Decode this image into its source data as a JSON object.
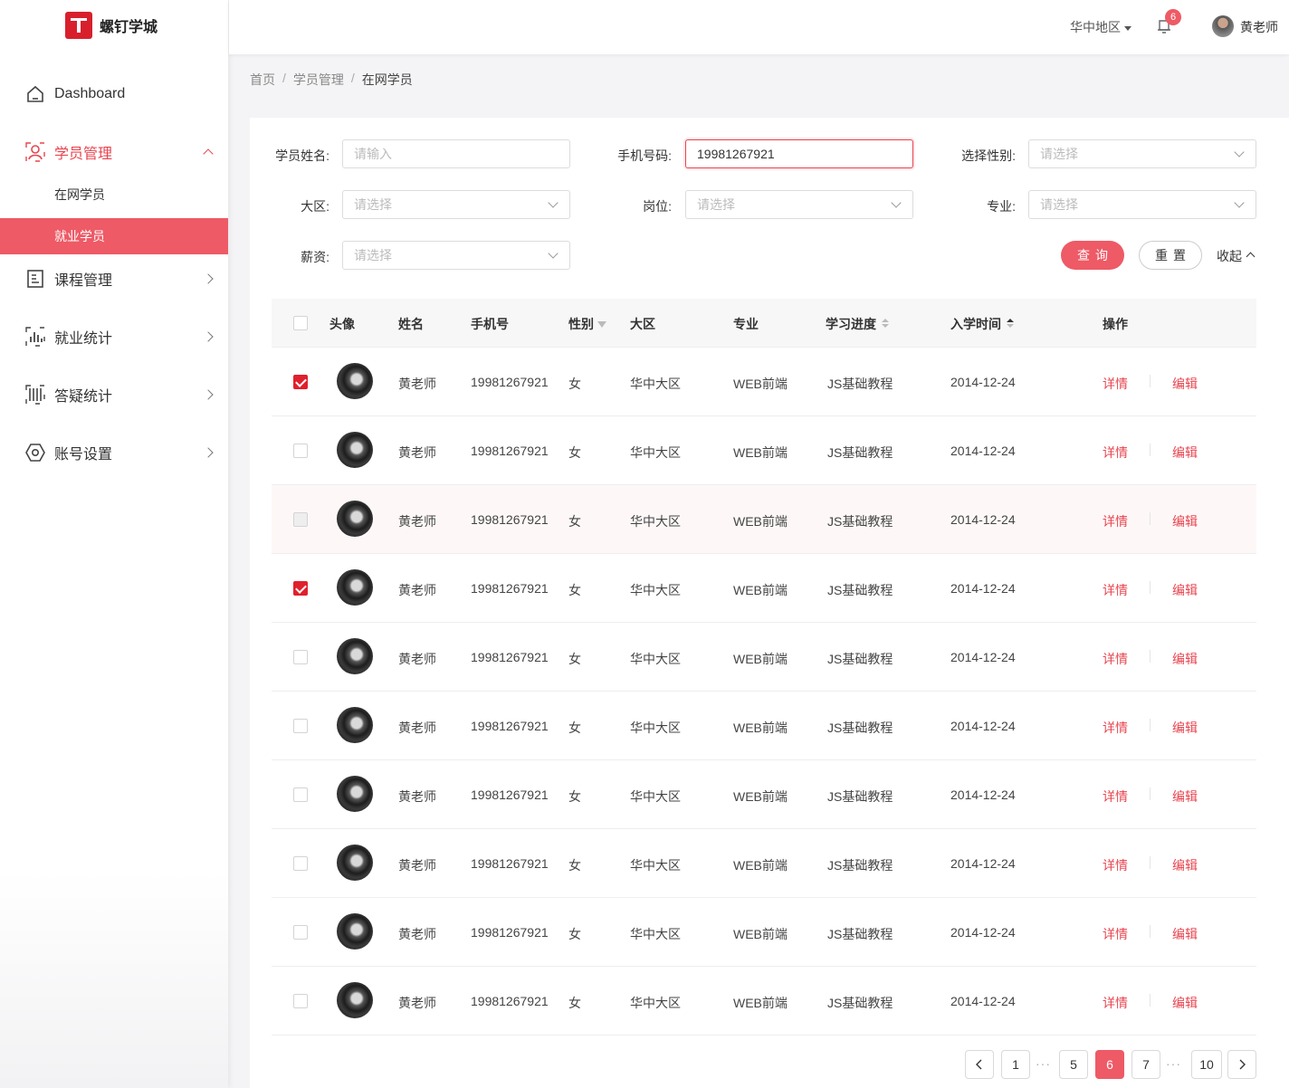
{
  "app": {
    "name": "螺钉学城",
    "accent": "#ee5a66",
    "brand": "#d8202d"
  },
  "sidebar": {
    "items": [
      {
        "label": "Dashboard",
        "icon": "home-icon"
      },
      {
        "label": "学员管理",
        "icon": "user-icon",
        "open": true,
        "children": [
          {
            "label": "在网学员"
          },
          {
            "label": "就业学员",
            "active": true
          }
        ]
      },
      {
        "label": "课程管理",
        "icon": "course-icon"
      },
      {
        "label": "就业统计",
        "icon": "chart-icon"
      },
      {
        "label": "答疑统计",
        "icon": "qa-icon"
      },
      {
        "label": "账号设置",
        "icon": "settings-icon"
      }
    ]
  },
  "header": {
    "region": "华中地区",
    "notifications": "6",
    "user": "黄老师"
  },
  "breadcrumb": [
    "首页",
    "学员管理",
    "在网学员"
  ],
  "filters": {
    "name_label": "学员姓名:",
    "name_placeholder": "请输入",
    "phone_label": "手机号码:",
    "phone_value": "19981267921",
    "gender_label": "选择性别:",
    "gender_placeholder": "请选择",
    "region_label": "大区:",
    "region_placeholder": "请选择",
    "post_label": "岗位:",
    "post_placeholder": "请选择",
    "major_label": "专业:",
    "major_placeholder": "请选择",
    "salary_label": "薪资:",
    "salary_placeholder": "请选择",
    "search_button": "查询",
    "reset_button": "重置",
    "collapse": "收起"
  },
  "table": {
    "columns": [
      "头像",
      "姓名",
      "手机号",
      "性别",
      "大区",
      "专业",
      "学习进度",
      "入学时间",
      "操作"
    ],
    "detail_label": "详情",
    "edit_label": "编辑",
    "rows": [
      {
        "name": "黄老师",
        "phone": "19981267921",
        "gender": "女",
        "region": "华中大区",
        "major": "WEB前端",
        "progress": "JS基础教程",
        "date": "2014-12-24",
        "checked": true
      },
      {
        "name": "黄老师",
        "phone": "19981267921",
        "gender": "女",
        "region": "华中大区",
        "major": "WEB前端",
        "progress": "JS基础教程",
        "date": "2014-12-24",
        "checked": false
      },
      {
        "name": "黄老师",
        "phone": "19981267921",
        "gender": "女",
        "region": "华中大区",
        "major": "WEB前端",
        "progress": "JS基础教程",
        "date": "2014-12-24",
        "checked": false,
        "disabled": true
      },
      {
        "name": "黄老师",
        "phone": "19981267921",
        "gender": "女",
        "region": "华中大区",
        "major": "WEB前端",
        "progress": "JS基础教程",
        "date": "2014-12-24",
        "checked": true
      },
      {
        "name": "黄老师",
        "phone": "19981267921",
        "gender": "女",
        "region": "华中大区",
        "major": "WEB前端",
        "progress": "JS基础教程",
        "date": "2014-12-24",
        "checked": false
      },
      {
        "name": "黄老师",
        "phone": "19981267921",
        "gender": "女",
        "region": "华中大区",
        "major": "WEB前端",
        "progress": "JS基础教程",
        "date": "2014-12-24",
        "checked": false
      },
      {
        "name": "黄老师",
        "phone": "19981267921",
        "gender": "女",
        "region": "华中大区",
        "major": "WEB前端",
        "progress": "JS基础教程",
        "date": "2014-12-24",
        "checked": false
      },
      {
        "name": "黄老师",
        "phone": "19981267921",
        "gender": "女",
        "region": "华中大区",
        "major": "WEB前端",
        "progress": "JS基础教程",
        "date": "2014-12-24",
        "checked": false
      },
      {
        "name": "黄老师",
        "phone": "19981267921",
        "gender": "女",
        "region": "华中大区",
        "major": "WEB前端",
        "progress": "JS基础教程",
        "date": "2014-12-24",
        "checked": false
      },
      {
        "name": "黄老师",
        "phone": "19981267921",
        "gender": "女",
        "region": "华中大区",
        "major": "WEB前端",
        "progress": "JS基础教程",
        "date": "2014-12-24",
        "checked": false
      }
    ]
  },
  "pagination": {
    "pages": [
      "1",
      "5",
      "6",
      "7",
      "10"
    ],
    "current": "6",
    "ellipsis": "···"
  }
}
